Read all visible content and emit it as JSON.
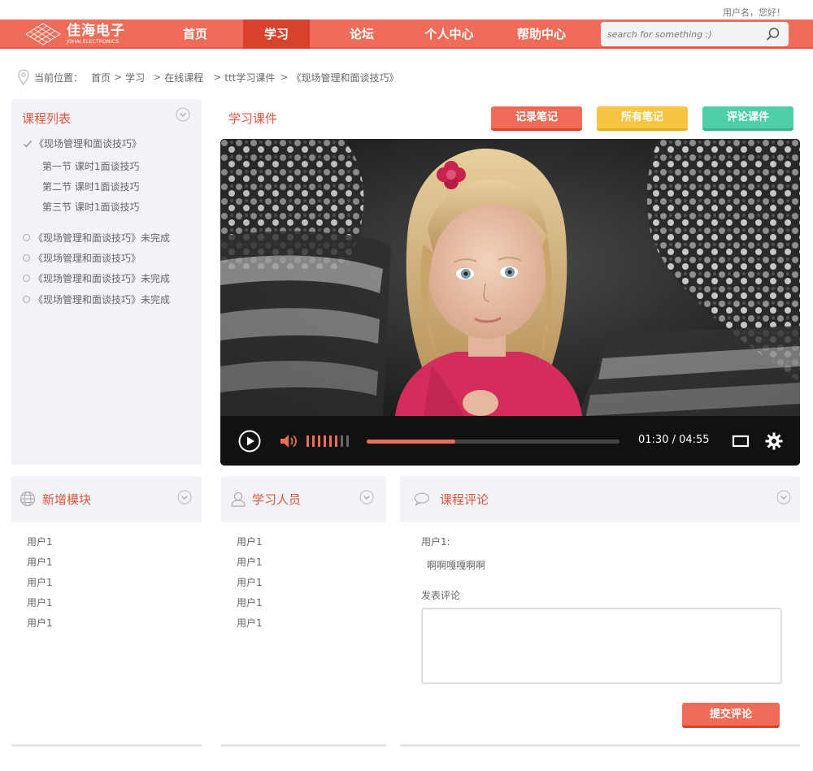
{
  "header": {
    "greeting": "用户名，您好！",
    "logo_cn": "佳海电子",
    "logo_en": "JOHAI ELECTRONICS",
    "nav": [
      {
        "label": "首页"
      },
      {
        "label": "学习"
      },
      {
        "label": "论坛"
      },
      {
        "label": "个人中心"
      },
      {
        "label": "帮助中心"
      }
    ],
    "active_nav": "学习",
    "search_placeholder": "search for something :)"
  },
  "breadcrumb": {
    "prefix": "当前位置：",
    "items": [
      "首页",
      "学习",
      "在线课程",
      "ttt学习课件",
      "《现场管理和面谈技巧》"
    ],
    "separator": ">"
  },
  "sidebar": {
    "title": "课程列表",
    "current_course": "《现场管理和面谈技巧》",
    "lessons": [
      "第一节  课时1面谈技巧",
      "第二节  课时1面谈技巧",
      "第三节  课时1面谈技巧"
    ],
    "other_courses": [
      "《现场管理和面谈技巧》未完成",
      "《现场管理和面谈技巧》",
      "《现场管理和面谈技巧》未完成",
      "《现场管理和面谈技巧》未完成"
    ]
  },
  "main": {
    "section_title": "学习课件",
    "buttons": {
      "record_note": "记录笔记",
      "all_notes": "所有笔记",
      "comment_course": "评论课件"
    },
    "player": {
      "time_display": "01:30 / 04:55",
      "progress": 0.35,
      "volume_level": 0.7
    }
  },
  "panels": {
    "new_module": {
      "title": "新增模块",
      "items": [
        "用户1",
        "用户1",
        "用户1",
        "用户1",
        "用户1"
      ]
    },
    "learners": {
      "title": "学习人员",
      "items": [
        "用户1",
        "用户1",
        "用户1",
        "用户1",
        "用户1"
      ]
    },
    "comments": {
      "title": "课程评论",
      "comment_user": "用户1:",
      "comment_text": "啊啊嘎嘎啊啊",
      "post_label": "发表评论",
      "submit_label": "提交评论"
    }
  },
  "colors": {
    "accent": "#ef6d58",
    "accent_dark": "#d9432d",
    "yellow": "#f7c541",
    "teal": "#4ecfa8"
  },
  "icons": [
    "logo-icon",
    "search-icon",
    "location-pin-icon",
    "chevron-down-icon",
    "check-icon",
    "circle-icon",
    "play-icon",
    "volume-icon",
    "fullscreen-icon",
    "gear-icon",
    "globe-icon",
    "user-icon",
    "speech-bubble-icon"
  ]
}
